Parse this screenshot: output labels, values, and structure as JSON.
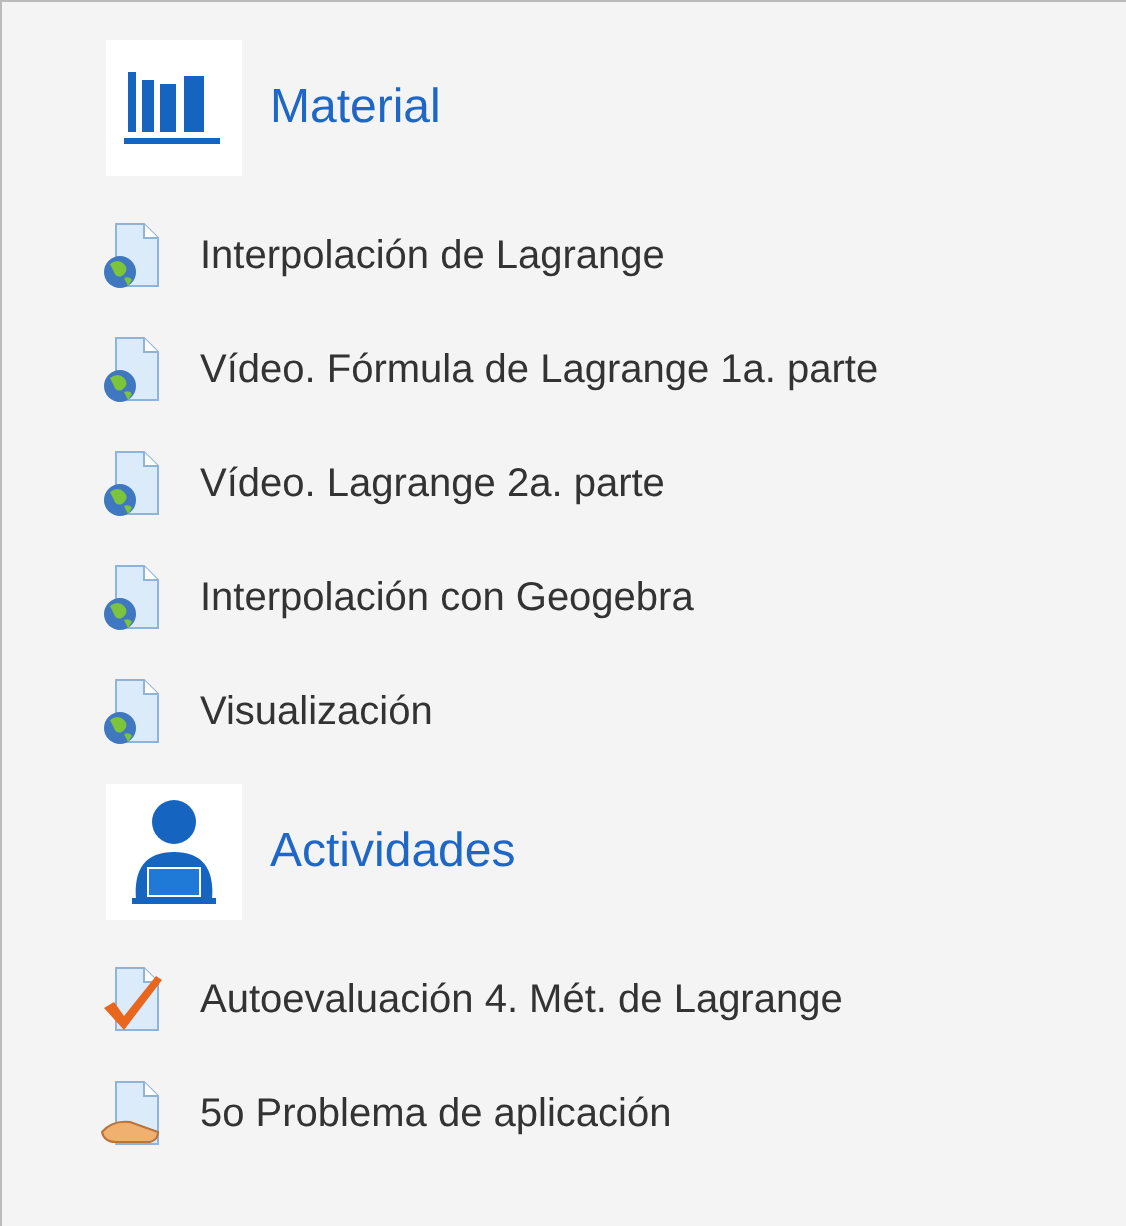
{
  "sections": [
    {
      "kind": "books",
      "title": "Material",
      "items": [
        {
          "kind": "url",
          "label": "Interpolación de Lagrange"
        },
        {
          "kind": "url",
          "label": "Vídeo. Fórmula de Lagrange 1a. parte"
        },
        {
          "kind": "url",
          "label": "Vídeo. Lagrange 2a. parte"
        },
        {
          "kind": "url",
          "label": "Interpolación con Geogebra"
        },
        {
          "kind": "url",
          "label": "Visualización"
        }
      ]
    },
    {
      "kind": "person",
      "title": "Actividades",
      "items": [
        {
          "kind": "quiz",
          "label": "Autoevaluación 4. Mét. de Lagrange"
        },
        {
          "kind": "assign",
          "label": "5o Problema de aplicación"
        }
      ]
    }
  ]
}
